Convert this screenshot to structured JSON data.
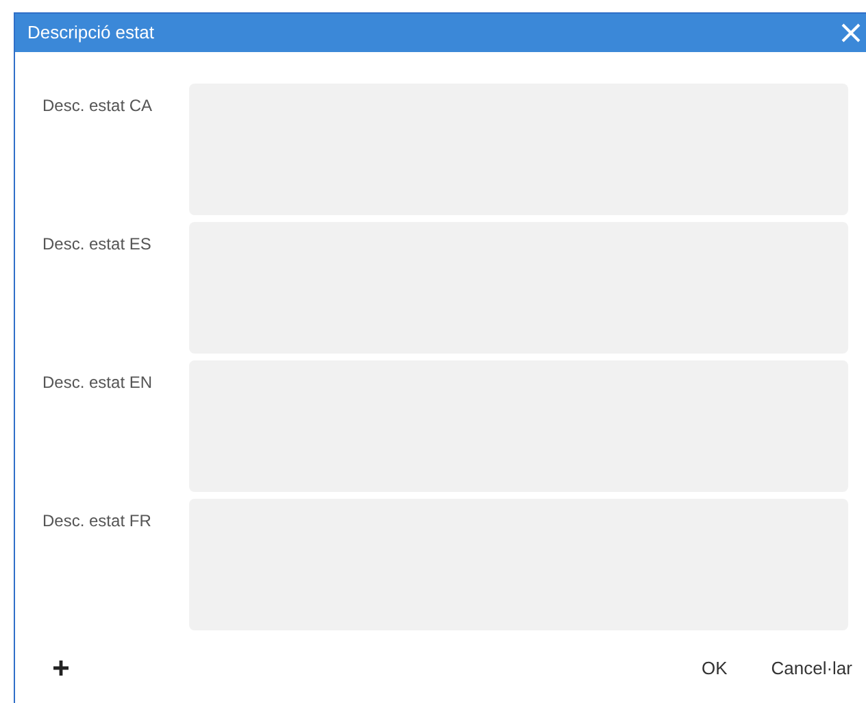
{
  "dialog": {
    "title": "Descripció estat"
  },
  "fields": [
    {
      "label": "Desc. estat CA"
    },
    {
      "label": "Desc. estat ES"
    },
    {
      "label": "Desc. estat EN"
    },
    {
      "label": "Desc. estat FR"
    }
  ],
  "buttons": [
    {
      "label": "OK"
    },
    {
      "label": "Cancel·lar"
    }
  ]
}
